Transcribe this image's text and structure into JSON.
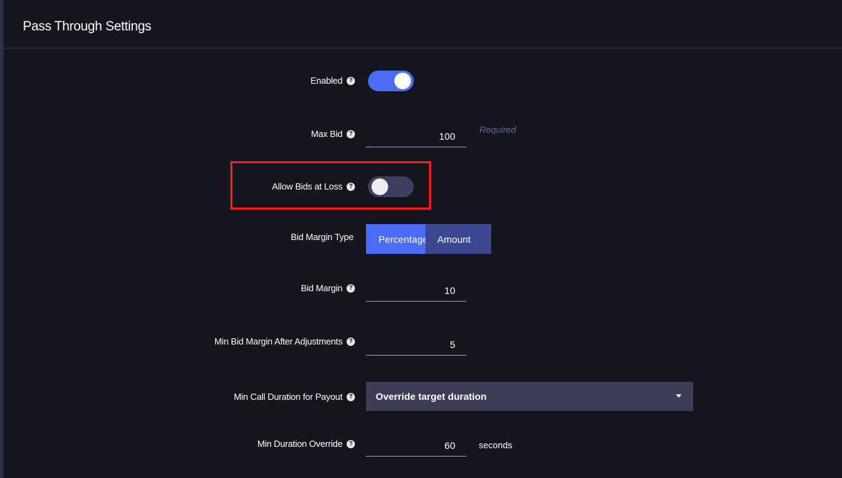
{
  "header": {
    "title": "Pass Through Settings"
  },
  "fields": {
    "enabled": {
      "label": "Enabled",
      "state": "on"
    },
    "max_bid": {
      "label": "Max Bid",
      "value": "100",
      "hint": "Required"
    },
    "allow_bids_at_loss": {
      "label": "Allow Bids at Loss",
      "state": "off"
    },
    "bid_margin_type": {
      "label": "Bid Margin Type",
      "options": [
        "Percentage",
        "Amount"
      ],
      "selected": "Percentage"
    },
    "bid_margin": {
      "label": "Bid Margin",
      "value": "10"
    },
    "min_bid_margin_after_adjustments": {
      "label": "Min Bid Margin After Adjustments",
      "value": "5"
    },
    "min_call_duration_for_payout": {
      "label": "Min Call Duration for Payout",
      "selected": "Override target duration"
    },
    "min_duration_override": {
      "label": "Min Duration Override",
      "value": "60",
      "suffix": "seconds"
    }
  },
  "icons": {
    "help": "help-circle-icon",
    "dropdown": "chevron-down-icon"
  },
  "colors": {
    "accent": "#4a6cf7",
    "highlight": "#ff1a1a",
    "background": "#15161d"
  }
}
